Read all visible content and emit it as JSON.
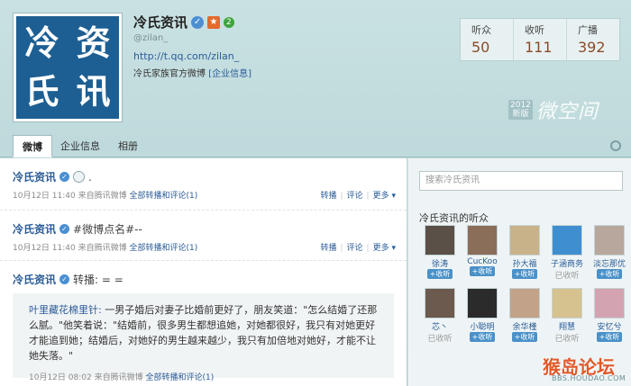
{
  "profile": {
    "logo_lines": [
      "冷",
      "资",
      "氏",
      "讯"
    ],
    "name": "冷氏资讯",
    "level": "2",
    "handle": "@zilan_",
    "url": "http://t.qq.com/zilan_",
    "description": "冷氏家族官方微博",
    "company_link": "[企业信息]"
  },
  "stats": [
    {
      "label": "听众",
      "value": "50"
    },
    {
      "label": "收听",
      "value": "111"
    },
    {
      "label": "广播",
      "value": "392"
    }
  ],
  "brand": {
    "year_top": "2012",
    "year_bottom": "新版",
    "name": "微空间"
  },
  "tabs": [
    {
      "label": "微博",
      "active": true
    },
    {
      "label": "企业信息",
      "active": false
    },
    {
      "label": "相册",
      "active": false
    }
  ],
  "posts": [
    {
      "author": "冷氏资讯",
      "text": ".",
      "time": "10月12日 11:40",
      "source": "来自腾讯微博",
      "repost_link": "全部转播和评论(1)",
      "actions": [
        "转播",
        "评论",
        "更多"
      ]
    },
    {
      "author": "冷氏资讯",
      "text": "#微博点名#--",
      "time": "10月12日 11:40",
      "source": "来自腾讯微博",
      "repost_link": "全部转播和评论(1)",
      "actions": [
        "转播",
        "评论",
        "更多"
      ]
    },
    {
      "author": "冷氏资讯",
      "text": "转播: = =",
      "quote": {
        "author": "叶里藏花棉里针:",
        "text": "一男子婚后对妻子比婚前更好了，朋友笑道：\"怎么结婚了还那么腻。\"他笑着说：\"结婚前，很多男生都想追她，对她都很好，我只有对她更好才能追到她；结婚后，对她好的男生越来越少，我只有加倍地对她好，才能不让她失落。\"",
        "time": "10月12日 08:02",
        "source": "来自腾讯微博",
        "repost_link": "全部转播和评论(1)"
      }
    }
  ],
  "side": {
    "search_placeholder": "搜索冷氏资讯",
    "listeners_title": "冷氏资讯的听众",
    "listeners": [
      {
        "name": "徐涛",
        "status": "+收听",
        "color": "#5a5048"
      },
      {
        "name": "CucKoo",
        "status": "+收听",
        "color": "#8a6e5a"
      },
      {
        "name": "孙大福",
        "status": "+收听",
        "color": "#c8b28a"
      },
      {
        "name": "子涵商务",
        "status": "已收听",
        "color": "#3f8fd0"
      },
      {
        "name": "淡忘那优",
        "status": "+收听",
        "color": "#b7a79c"
      },
      {
        "name": "芯丶",
        "status": "已收听",
        "color": "#6b5a4d"
      },
      {
        "name": "小聪明",
        "status": "+收听",
        "color": "#2b2b2b"
      },
      {
        "name": "余华槿",
        "status": "+收听",
        "color": "#c2a389"
      },
      {
        "name": "翔慧",
        "status": "已收听",
        "color": "#d5c28f"
      },
      {
        "name": "安忆兮",
        "status": "+收听",
        "color": "#d4a3b1"
      }
    ]
  },
  "watermark": {
    "main": "猴岛论坛",
    "sub": "BBS.HOUDAO.COM"
  }
}
